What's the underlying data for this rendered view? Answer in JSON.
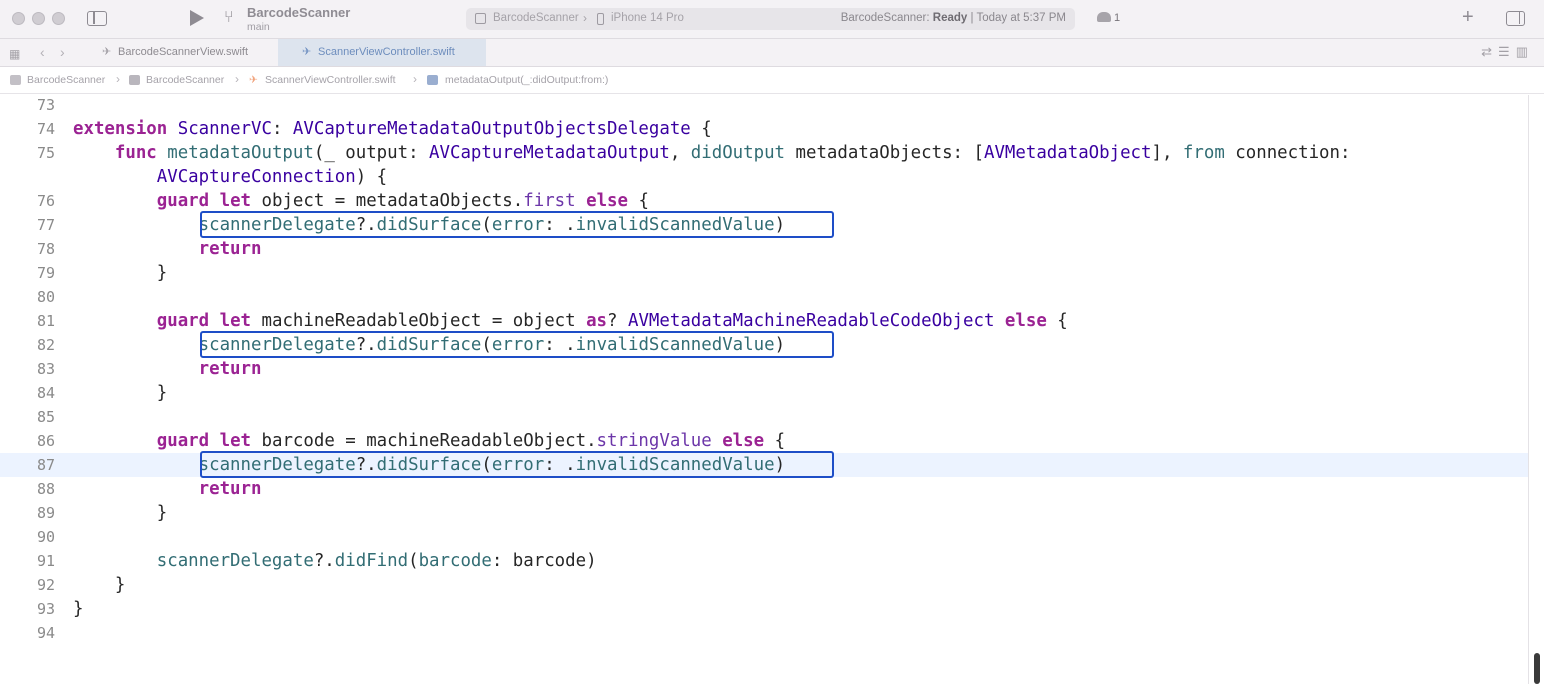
{
  "toolbar": {
    "project_name": "BarcodeScanner",
    "branch": "main",
    "scheme": "BarcodeScanner",
    "device": "iPhone 14 Pro",
    "status_app": "BarcodeScanner:",
    "status_state": "Ready",
    "status_time": "| Today at 5:37 PM",
    "warning_count": "1",
    "icons": [
      "sidebar-toggle-icon",
      "run-icon",
      "branch-icon",
      "warning-icon",
      "plus-icon",
      "inspector-toggle-icon"
    ]
  },
  "tabs": [
    {
      "label": "BarcodeScannerView.swift",
      "active": false
    },
    {
      "label": "ScannerViewController.swift",
      "active": true
    }
  ],
  "jumpbar": {
    "items": [
      "BarcodeScanner",
      "BarcodeScanner",
      "ScannerViewController.swift",
      "metadataOutput(_:didOutput:from:)"
    ]
  },
  "editor": {
    "current_line": 87,
    "lines": [
      {
        "n": "73",
        "tokens": []
      },
      {
        "n": "74",
        "tokens": [
          [
            "kw",
            "extension"
          ],
          [
            "t",
            " "
          ],
          [
            "ty",
            "ScannerVC"
          ],
          [
            "t",
            ": "
          ],
          [
            "ty",
            "AVCaptureMetadataOutputObjectsDelegate"
          ],
          [
            "t",
            " {"
          ]
        ]
      },
      {
        "n": "75",
        "tokens": [
          [
            "t",
            "    "
          ],
          [
            "kw",
            "func"
          ],
          [
            "t",
            " "
          ],
          [
            "fn",
            "metadataOutput"
          ],
          [
            "t",
            "(_ output: "
          ],
          [
            "ty",
            "AVCaptureMetadataOutput"
          ],
          [
            "t",
            ", "
          ],
          [
            "fn",
            "didOutput"
          ],
          [
            "t",
            " metadataObjects: ["
          ],
          [
            "ty",
            "AVMetadataObject"
          ],
          [
            "t",
            "], "
          ],
          [
            "fn",
            "from"
          ],
          [
            "t",
            " connection:"
          ]
        ]
      },
      {
        "n": "",
        "tokens": [
          [
            "t",
            "        "
          ],
          [
            "ty",
            "AVCaptureConnection"
          ],
          [
            "t",
            ") {"
          ]
        ]
      },
      {
        "n": "76",
        "tokens": [
          [
            "t",
            "        "
          ],
          [
            "kw",
            "guard"
          ],
          [
            "t",
            " "
          ],
          [
            "kw",
            "let"
          ],
          [
            "t",
            " object = metadataObjects."
          ],
          [
            "pr",
            "first"
          ],
          [
            "t",
            " "
          ],
          [
            "kw",
            "else"
          ],
          [
            "t",
            " {"
          ]
        ]
      },
      {
        "n": "77",
        "tokens": [
          [
            "t",
            "            "
          ],
          [
            "fn",
            "scannerDelegate"
          ],
          [
            "t",
            "?."
          ],
          [
            "fn",
            "didSurface"
          ],
          [
            "t",
            "("
          ],
          [
            "fn",
            "error"
          ],
          [
            "t",
            ": ."
          ],
          [
            "fn",
            "invalidScannedValue"
          ],
          [
            "t",
            ")"
          ]
        ],
        "boxed": true
      },
      {
        "n": "78",
        "tokens": [
          [
            "t",
            "            "
          ],
          [
            "kw",
            "return"
          ]
        ]
      },
      {
        "n": "79",
        "tokens": [
          [
            "t",
            "        }"
          ]
        ]
      },
      {
        "n": "80",
        "tokens": []
      },
      {
        "n": "81",
        "tokens": [
          [
            "t",
            "        "
          ],
          [
            "kw",
            "guard"
          ],
          [
            "t",
            " "
          ],
          [
            "kw",
            "let"
          ],
          [
            "t",
            " machineReadableObject = object "
          ],
          [
            "kw",
            "as"
          ],
          [
            "t",
            "? "
          ],
          [
            "ty",
            "AVMetadataMachineReadableCodeObject"
          ],
          [
            "t",
            " "
          ],
          [
            "kw",
            "else"
          ],
          [
            "t",
            " {"
          ]
        ]
      },
      {
        "n": "82",
        "tokens": [
          [
            "t",
            "            "
          ],
          [
            "fn",
            "scannerDelegate"
          ],
          [
            "t",
            "?."
          ],
          [
            "fn",
            "didSurface"
          ],
          [
            "t",
            "("
          ],
          [
            "fn",
            "error"
          ],
          [
            "t",
            ": ."
          ],
          [
            "fn",
            "invalidScannedValue"
          ],
          [
            "t",
            ")"
          ]
        ],
        "boxed": true
      },
      {
        "n": "83",
        "tokens": [
          [
            "t",
            "            "
          ],
          [
            "kw",
            "return"
          ]
        ]
      },
      {
        "n": "84",
        "tokens": [
          [
            "t",
            "        }"
          ]
        ]
      },
      {
        "n": "85",
        "tokens": []
      },
      {
        "n": "86",
        "tokens": [
          [
            "t",
            "        "
          ],
          [
            "kw",
            "guard"
          ],
          [
            "t",
            " "
          ],
          [
            "kw",
            "let"
          ],
          [
            "t",
            " barcode = machineReadableObject."
          ],
          [
            "pr",
            "stringValue"
          ],
          [
            "t",
            " "
          ],
          [
            "kw",
            "else"
          ],
          [
            "t",
            " {"
          ]
        ]
      },
      {
        "n": "87",
        "tokens": [
          [
            "t",
            "            "
          ],
          [
            "fn",
            "scannerDelegate"
          ],
          [
            "t",
            "?."
          ],
          [
            "fn",
            "didSurface"
          ],
          [
            "t",
            "("
          ],
          [
            "fn",
            "error"
          ],
          [
            "t",
            ": ."
          ],
          [
            "fn",
            "invalidScannedValue"
          ],
          [
            "t",
            ")"
          ]
        ],
        "boxed": true
      },
      {
        "n": "88",
        "tokens": [
          [
            "t",
            "            "
          ],
          [
            "kw",
            "return"
          ]
        ]
      },
      {
        "n": "89",
        "tokens": [
          [
            "t",
            "        }"
          ]
        ]
      },
      {
        "n": "90",
        "tokens": []
      },
      {
        "n": "91",
        "tokens": [
          [
            "t",
            "        "
          ],
          [
            "fn",
            "scannerDelegate"
          ],
          [
            "t",
            "?."
          ],
          [
            "fn",
            "didFind"
          ],
          [
            "t",
            "("
          ],
          [
            "fn",
            "barcode"
          ],
          [
            "t",
            ": barcode)"
          ]
        ]
      },
      {
        "n": "92",
        "tokens": [
          [
            "t",
            "    }"
          ]
        ]
      },
      {
        "n": "93",
        "tokens": [
          [
            "t",
            "}"
          ]
        ]
      },
      {
        "n": "94",
        "tokens": []
      }
    ]
  },
  "colors": {
    "keyword": "#9b2393",
    "type": "#3900a0",
    "function": "#326d74",
    "highlight_box": "#1e4ec7",
    "current_line": "#ecf3ff"
  }
}
